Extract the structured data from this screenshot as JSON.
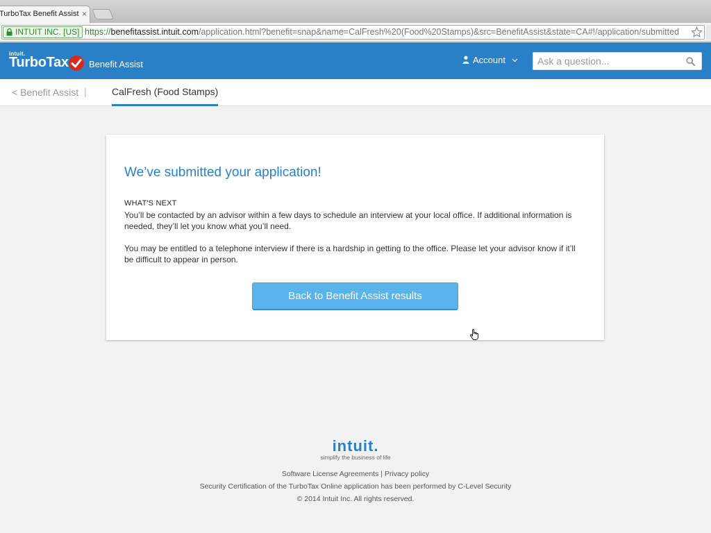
{
  "browser": {
    "tab_title": "TurboTax Benefit Assist",
    "tab_close": "×",
    "ev_label": "INTUIT INC. [US]",
    "url_scheme": "https://",
    "url_host": "benefitassist.intuit.com",
    "url_rest": "/application.html?benefit=snap&name=CalFresh%20(Food%20Stamps)&src=BenefitAssist&state=CA#!/application/submitted"
  },
  "header": {
    "brand_small": "intuit.",
    "brand_name": "TurboTax",
    "brand_product": "Benefit Assist",
    "account_label": "Account",
    "search_placeholder": "Ask a question...",
    "search_value": ""
  },
  "subnav": {
    "back_label": "< Benefit Assist",
    "separator": "|",
    "active_tab": "CalFresh (Food Stamps)"
  },
  "card": {
    "title": "We’ve submitted your application!",
    "section_heading": "WHAT'S NEXT",
    "paragraph_1": "You’ll be contacted by an advisor within a few days to schedule an interview at your local office. If additional information is needed, they’ll let you know what you’ll need.",
    "paragraph_2": "You may be entitled to a telephone interview if there is a hardship in getting to the office. Please let your advisor know if it’ll be difficult to appear in person.",
    "button_label": "Back to Benefit Assist results"
  },
  "footer": {
    "logo": "intuit.",
    "tagline": "simplify the business of life",
    "link_licenses": "Software License Agreements",
    "link_separator": "|",
    "link_privacy": "Privacy policy",
    "security_line": "Security Certification of the TurboTax Online application has been performed by C-Level Security",
    "copyright": "© 2014 Intuit Inc. All rights reserved."
  },
  "colors": {
    "brand_blue": "#2a80c6",
    "button_blue": "#5ab4ec",
    "check_red": "#d52b1e",
    "page_bg": "#f2f2f2"
  },
  "icons": [
    "lock-icon",
    "bookmark-star-icon",
    "checkmark-logo-icon",
    "person-icon",
    "chevron-down-icon",
    "search-icon",
    "hand-cursor-icon"
  ]
}
